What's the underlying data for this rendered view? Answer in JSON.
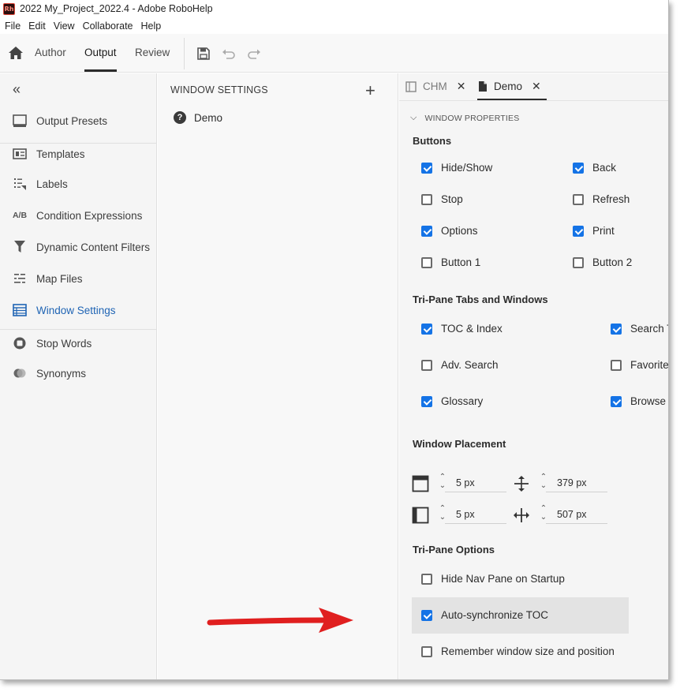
{
  "window": {
    "title": "2022 My_Project_2022.4 - Adobe RoboHelp",
    "logo_text": "Rh"
  },
  "menu": [
    "File",
    "Edit",
    "View",
    "Collaborate",
    "Help"
  ],
  "toolbar": {
    "tabs": [
      "Author",
      "Output",
      "Review"
    ],
    "active_tab": "Output"
  },
  "sidebar": {
    "collapse_glyph": "«",
    "items": [
      {
        "label": "Output Presets",
        "icon": "output-presets-icon"
      },
      {
        "label": "Templates",
        "icon": "templates-icon"
      },
      {
        "label": "Labels",
        "icon": "labels-icon"
      },
      {
        "label": "Condition Expressions",
        "icon": "ab-icon",
        "icon_text": "A/B"
      },
      {
        "label": "Dynamic Content Filters",
        "icon": "filter-icon"
      },
      {
        "label": "Map Files",
        "icon": "map-files-icon"
      },
      {
        "label": "Window Settings",
        "icon": "window-settings-icon",
        "active": true
      },
      {
        "label": "Stop Words",
        "icon": "stop-words-icon"
      },
      {
        "label": "Synonyms",
        "icon": "synonyms-icon"
      }
    ]
  },
  "middle": {
    "title": "WINDOW SETTINGS",
    "items": [
      "Demo"
    ]
  },
  "right": {
    "tabs": [
      {
        "label": "CHM",
        "active": false
      },
      {
        "label": "Demo",
        "active": true
      }
    ],
    "section": "WINDOW PROPERTIES",
    "buttons_group": {
      "title": "Buttons",
      "items": [
        {
          "label": "Hide/Show",
          "checked": true
        },
        {
          "label": "Back",
          "checked": true
        },
        {
          "label": "Stop",
          "checked": false
        },
        {
          "label": "Refresh",
          "checked": false
        },
        {
          "label": "Options",
          "checked": true
        },
        {
          "label": "Print",
          "checked": true
        },
        {
          "label": "Button 1",
          "checked": false
        },
        {
          "label": "Button 2",
          "checked": false
        }
      ]
    },
    "tripane_tabs_group": {
      "title": "Tri-Pane Tabs and Windows",
      "items": [
        {
          "label": "TOC & Index",
          "checked": true
        },
        {
          "label": "Search Ta",
          "checked": true
        },
        {
          "label": "Adv. Search",
          "checked": false
        },
        {
          "label": "Favorites",
          "checked": false
        },
        {
          "label": "Glossary",
          "checked": true
        },
        {
          "label": "Browse S",
          "checked": true
        }
      ]
    },
    "placement": {
      "title": "Window Placement",
      "top": "5 px",
      "height": "379 px",
      "left": "5 px",
      "width": "507 px"
    },
    "tripane_options": {
      "title": "Tri-Pane Options",
      "items": [
        {
          "label": "Hide Nav Pane on Startup",
          "checked": false
        },
        {
          "label": "Auto-synchronize TOC",
          "checked": true,
          "highlighted": true
        },
        {
          "label": "Remember window size and position",
          "checked": false
        }
      ]
    }
  },
  "colors": {
    "accent": "#1473e6",
    "active_link": "#1f64b4",
    "arrow": "#e01f1f"
  }
}
